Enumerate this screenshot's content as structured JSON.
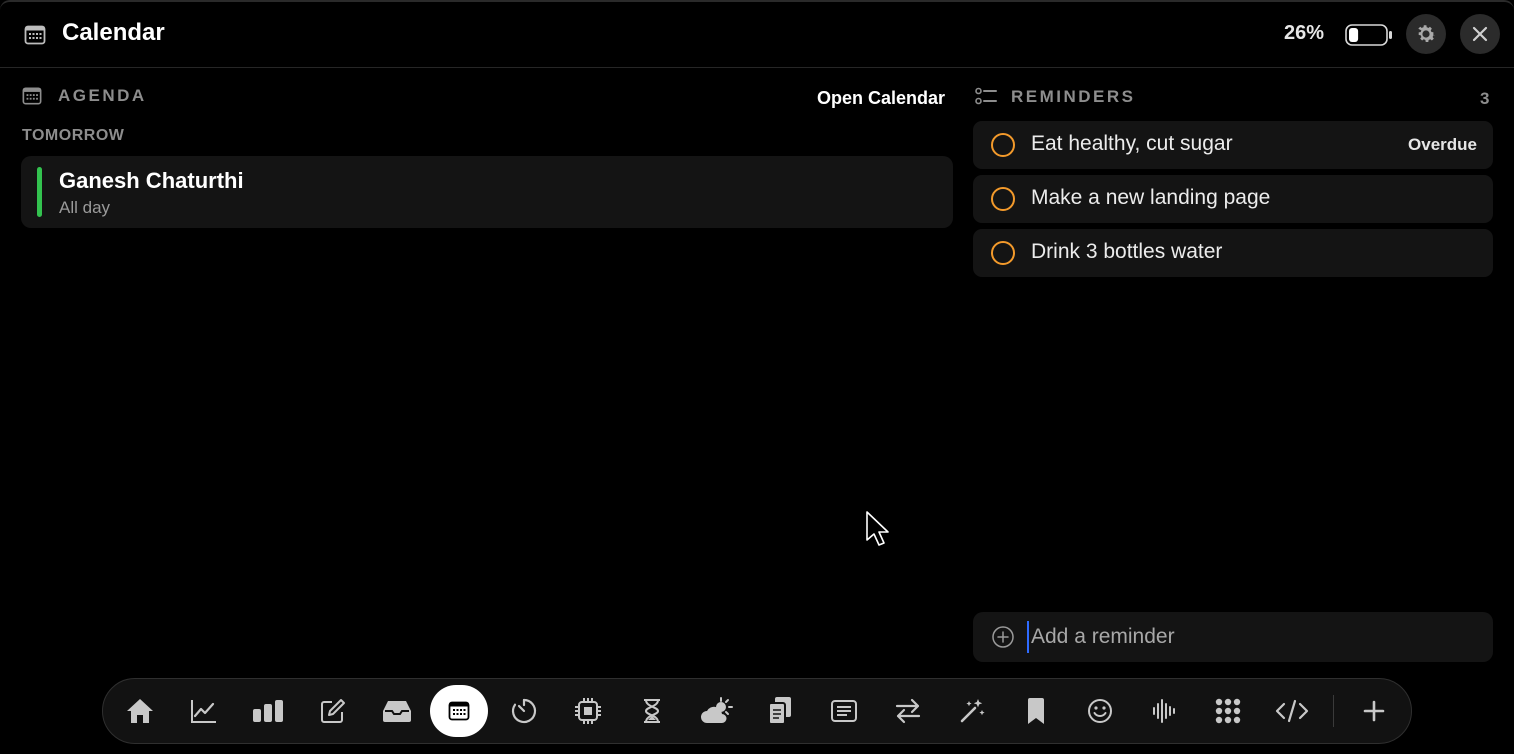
{
  "header": {
    "title": "Calendar",
    "app_icon": "calendar-icon",
    "battery_percent": "26%",
    "battery_level": 0.26
  },
  "agenda": {
    "title": "AGENDA",
    "open_calendar_label": "Open Calendar",
    "day_label": "TOMORROW",
    "events": [
      {
        "title": "Ganesh Chaturthi",
        "subtitle": "All day",
        "color": "#33c24f"
      }
    ]
  },
  "reminders": {
    "title": "REMINDERS",
    "count": "3",
    "items": [
      {
        "text": "Eat healthy, cut sugar",
        "tag": "Overdue"
      },
      {
        "text": "Make a new landing page",
        "tag": ""
      },
      {
        "text": "Drink 3 bottles water",
        "tag": ""
      }
    ],
    "add_placeholder": "Add a reminder",
    "circle_color": "#f39a2b"
  },
  "dock": {
    "items": [
      "home-icon",
      "chart-line-icon",
      "bar-chart-icon",
      "compose-icon",
      "inbox-icon",
      "calendar-icon",
      "timer-icon",
      "cpu-icon",
      "hourglass-icon",
      "weather-icon",
      "clipboard-icon",
      "notes-icon",
      "convert-icon",
      "magic-wand-icon",
      "bookmark-icon",
      "emoji-icon",
      "audio-wave-icon",
      "apps-grid-icon",
      "code-icon",
      "add-icon"
    ],
    "active": "calendar-icon"
  }
}
